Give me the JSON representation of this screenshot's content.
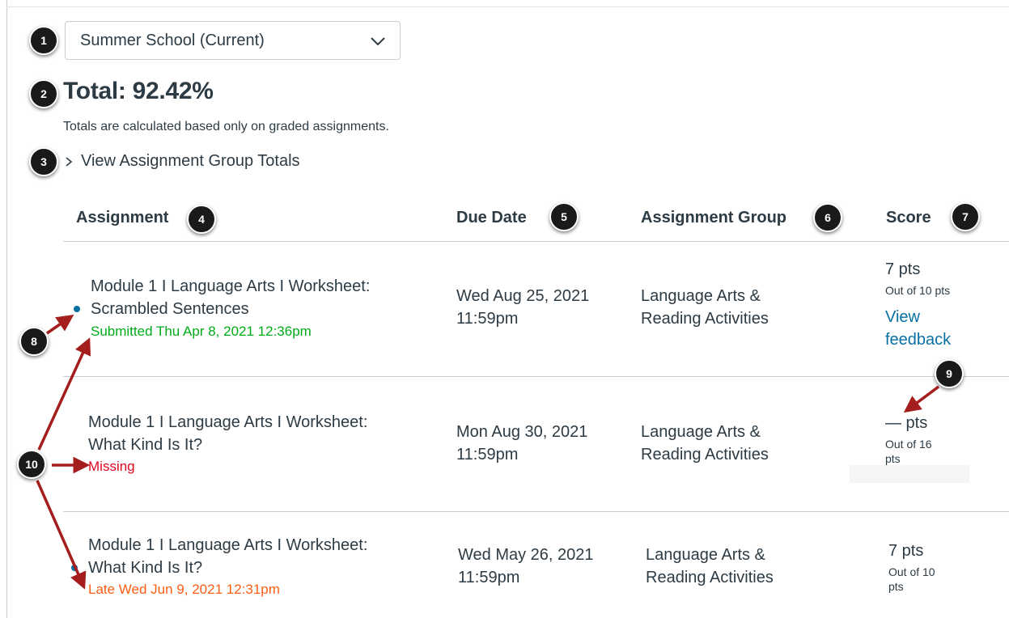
{
  "term_select": {
    "value": "Summer School (Current)",
    "icon": "chevron-down-icon"
  },
  "total": {
    "label": "Total: 92.42%",
    "note": "Totals are calculated based only on graded assignments."
  },
  "group_totals_toggle": {
    "label": "View Assignment Group Totals",
    "icon": "chevron-right-icon"
  },
  "table": {
    "headers": [
      "Assignment",
      "Due Date",
      "Assignment Group",
      "Score"
    ],
    "rows": [
      {
        "title_line1": "Module 1 I Language Arts I Worksheet:",
        "title_line2": "Scrambled Sentences",
        "status": "Submitted Thu Apr 8, 2021 12:36pm",
        "status_type": "submitted",
        "due_line1": "Wed Aug 25, 2021",
        "due_line2": "11:59pm",
        "group_line1": "Language Arts &",
        "group_line2": "Reading Activities",
        "score": "7 pts",
        "out_of": "Out of 10 pts",
        "feedback_line1": "View",
        "feedback_line2": "feedback"
      },
      {
        "title_line1": "Module 1 I Language Arts I Worksheet:",
        "title_line2": "What Kind Is It?",
        "status": "Missing",
        "status_type": "missing",
        "due_line1": "Mon Aug 30, 2021",
        "due_line2": "11:59pm",
        "group_line1": "Language Arts &",
        "group_line2": "Reading Activities",
        "score": "— pts",
        "out_of_line1": "Out of 16",
        "out_of_line2": "pts"
      },
      {
        "title_line1": "Module 1 I Language Arts I Worksheet:",
        "title_line2": "What Kind Is It?",
        "status": "Late Wed Jun 9, 2021 12:31pm",
        "status_type": "late",
        "due_line1": "Wed May 26, 2021",
        "due_line2": "11:59pm",
        "group_line1": "Language Arts &",
        "group_line2": "Reading Activities",
        "score": "7 pts",
        "out_of_line1": "Out of 10",
        "out_of_line2": "pts"
      }
    ]
  },
  "callouts": [
    "1",
    "2",
    "3",
    "4",
    "5",
    "6",
    "7",
    "8",
    "9",
    "10"
  ],
  "colors": {
    "link": "#0770a3",
    "submitted": "#00ac18",
    "missing": "#e0061f",
    "late": "#fc5e13",
    "arrow": "#a51e1e",
    "unread_dot": "#0770a3"
  }
}
